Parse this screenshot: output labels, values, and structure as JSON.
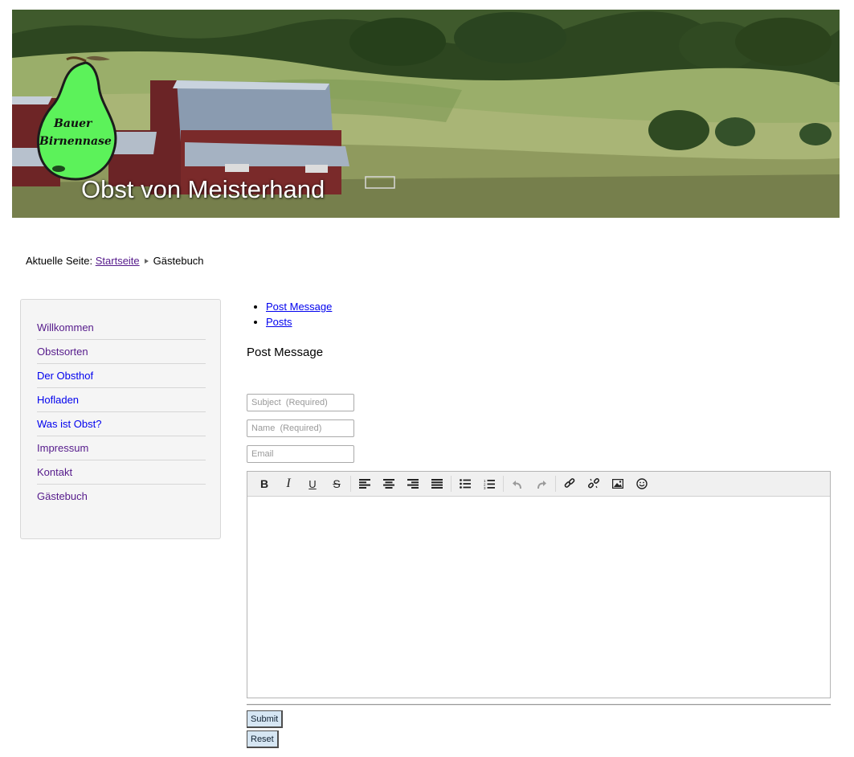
{
  "banner": {
    "title": "Obst von Meisterhand",
    "logo_line1": "Bauer",
    "logo_line2": "Birnennase"
  },
  "breadcrumb": {
    "prefix": "Aktuelle Seite:",
    "home": "Startseite",
    "current": "Gästebuch"
  },
  "sidebar": {
    "items": [
      {
        "label": "Willkommen"
      },
      {
        "label": "Obstsorten"
      },
      {
        "label": "Der Obsthof"
      },
      {
        "label": "Hofladen"
      },
      {
        "label": "Was ist Obst?"
      },
      {
        "label": "Impressum"
      },
      {
        "label": "Kontakt"
      },
      {
        "label": "Gästebuch"
      }
    ]
  },
  "main": {
    "links": [
      {
        "label": "Post Message"
      },
      {
        "label": "Posts"
      }
    ],
    "section_title": "Post Message",
    "form": {
      "subject_placeholder": "Subject  (Required)",
      "name_placeholder": "Name  (Required)",
      "email_placeholder": "Email",
      "submit_label": "Submit",
      "reset_label": "Reset"
    },
    "toolbar": [
      "bold-icon",
      "italic-icon",
      "underline-icon",
      "strikethrough-icon",
      "align-left-icon",
      "align-center-icon",
      "align-right-icon",
      "align-justify-icon",
      "bullet-list-icon",
      "numbered-list-icon",
      "undo-icon",
      "redo-icon",
      "link-icon",
      "unlink-icon",
      "image-icon",
      "emoticon-icon"
    ]
  },
  "colors": {
    "link": "#0000ee",
    "visited": "#551a8b",
    "button_bg": "#d6e6f3",
    "logo_pear": "#5cf25a"
  }
}
